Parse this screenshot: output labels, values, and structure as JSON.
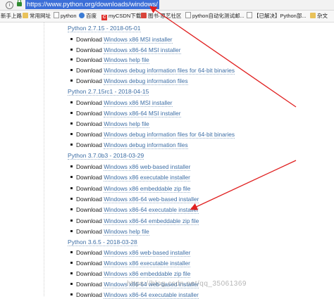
{
  "address_bar": {
    "url": "https://www.python.org/downloads/windows/"
  },
  "bookmarks": [
    {
      "label": "新手上路",
      "icon": "none"
    },
    {
      "label": "常用网址",
      "icon": "folder-icon"
    },
    {
      "label": "python",
      "icon": "page-icon"
    },
    {
      "label": "百度",
      "icon": "paw-icon"
    },
    {
      "label": "myCSDN下载",
      "icon": "csdn-icon"
    },
    {
      "label": "图书·思艺社区",
      "icon": "book-icon"
    },
    {
      "label": "python自动化测试邮...",
      "icon": "page-icon"
    },
    {
      "label": "【已解决】Python部...",
      "icon": "page-icon"
    },
    {
      "label": "杂文",
      "icon": "folder-icon"
    }
  ],
  "common": {
    "download_word": "Download"
  },
  "releases": [
    {
      "title": "Python 2.7.15 - 2018-05-01",
      "files": [
        "Windows x86 MSI installer",
        "Windows x86-64 MSI installer",
        "Windows help file",
        "Windows debug information files for 64-bit binaries",
        "Windows debug information files"
      ]
    },
    {
      "title": "Python 2.7.15rc1 - 2018-04-15",
      "files": [
        "Windows x86 MSI installer",
        "Windows x86-64 MSI installer",
        "Windows help file",
        "Windows debug information files for 64-bit binaries",
        "Windows debug information files"
      ]
    },
    {
      "title": "Python 3.7.0b3 - 2018-03-29",
      "files": [
        "Windows x86 web-based installer",
        "Windows x86 executable installer",
        "Windows x86 embeddable zip file",
        "Windows x86-64 web-based installer",
        "Windows x86-64 executable installer",
        "Windows x86-64 embeddable zip file",
        "Windows help file"
      ]
    },
    {
      "title": "Python 3.6.5 - 2018-03-28",
      "files": [
        "Windows x86 web-based installer",
        "Windows x86 executable installer",
        "Windows x86 embeddable zip file",
        "Windows x86-64 web-based installer",
        "Windows x86-64 executable installer"
      ]
    }
  ],
  "watermark": "https://blog.csdn.net/qq_35061369",
  "colors": {
    "link": "#3d6ea5",
    "annotation": "#e02020",
    "url_highlight": "#3c6fd8"
  }
}
